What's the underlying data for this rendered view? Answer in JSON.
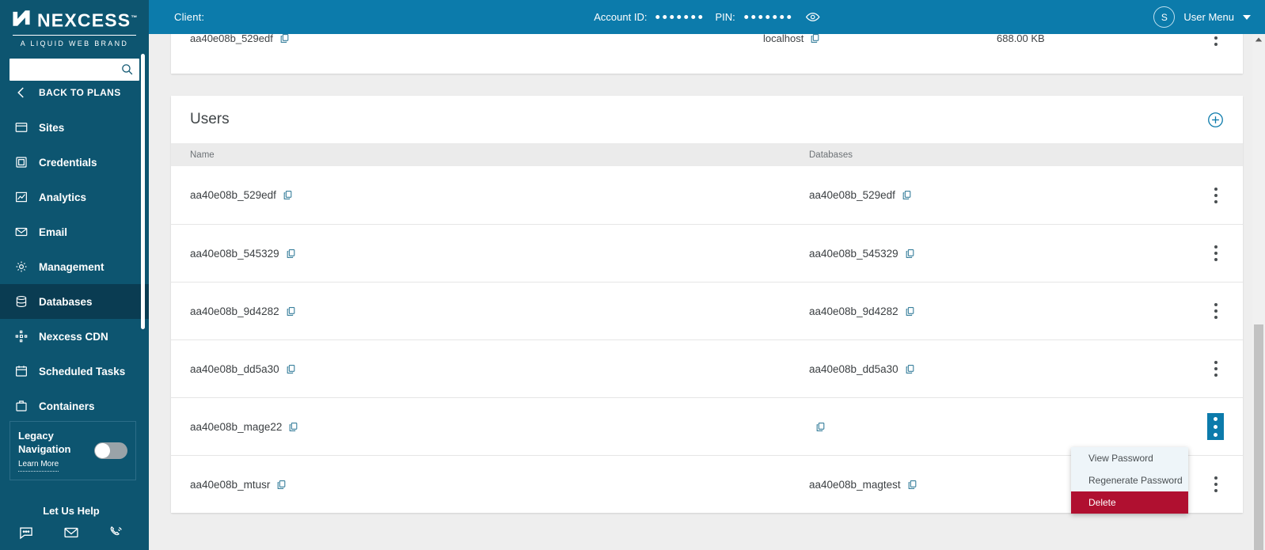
{
  "brand": {
    "name": "NEXCESS",
    "tm": "™",
    "tagline": "A LIQUID WEB BRAND",
    "logo_icon": "nexcess-n-logo-icon",
    "sidebar_bg": "#0d5570",
    "topbar_bg": "#0c7bab",
    "accent": "#0c7bab",
    "danger": "#b01030"
  },
  "sidebar": {
    "search": {
      "value": "",
      "placeholder": "",
      "icon": "search-icon"
    },
    "back_link": {
      "label": "BACK TO PLANS",
      "icon": "chevron-left-icon"
    },
    "items": [
      {
        "label": "Sites",
        "icon": "window-icon",
        "active": false
      },
      {
        "label": "Credentials",
        "icon": "id-card-icon",
        "active": false
      },
      {
        "label": "Analytics",
        "icon": "line-chart-icon",
        "active": false
      },
      {
        "label": "Email",
        "icon": "envelope-icon",
        "active": false
      },
      {
        "label": "Management",
        "icon": "gear-icon",
        "active": false
      },
      {
        "label": "Databases",
        "icon": "database-icon",
        "active": true
      },
      {
        "label": "Nexcess CDN",
        "icon": "cdn-nodes-icon",
        "active": false
      },
      {
        "label": "Scheduled Tasks",
        "icon": "calendar-icon",
        "active": false
      },
      {
        "label": "Containers",
        "icon": "container-box-icon",
        "active": false
      }
    ],
    "legacy": {
      "line1": "Legacy",
      "line2": "Navigation",
      "learn_more": "Learn More",
      "toggle_state": "off"
    },
    "help": {
      "title": "Let Us Help",
      "icons": [
        "chat-icon",
        "envelope-icon",
        "phone-icon"
      ]
    }
  },
  "topbar": {
    "client_label": "Client:",
    "account_id_label": "Account ID:",
    "account_id_masked_count": 7,
    "pin_label": "PIN:",
    "pin_masked_count": 7,
    "eye_icon": "eye-icon",
    "avatar_initial": "S",
    "user_menu_label": "User Menu",
    "caret_icon": "chevron-down-icon"
  },
  "databases_table": {
    "partial_row": {
      "name": "aa40e08b_529edf",
      "host": "localhost",
      "size": "688.00 KB",
      "copy_icon": "copy-icon",
      "kebab_icon": "kebab-menu-icon"
    }
  },
  "users_panel": {
    "title": "Users",
    "add_icon": "plus-circle-icon",
    "columns": [
      "Name",
      "Databases"
    ],
    "rows": [
      {
        "name": "aa40e08b_529edf",
        "database": "aa40e08b_529edf",
        "menu_open": false
      },
      {
        "name": "aa40e08b_545329",
        "database": "aa40e08b_545329",
        "menu_open": false
      },
      {
        "name": "aa40e08b_9d4282",
        "database": "aa40e08b_9d4282",
        "menu_open": false
      },
      {
        "name": "aa40e08b_dd5a30",
        "database": "aa40e08b_dd5a30",
        "menu_open": false
      },
      {
        "name": "aa40e08b_mage22",
        "database": "",
        "menu_open": true
      },
      {
        "name": "aa40e08b_mtusr",
        "database": "aa40e08b_magtest",
        "menu_open": false
      }
    ]
  },
  "context_menu": {
    "items": [
      {
        "label": "View Password",
        "danger": false
      },
      {
        "label": "Regenerate Password",
        "danger": false
      },
      {
        "label": "Delete",
        "danger": true
      }
    ]
  }
}
